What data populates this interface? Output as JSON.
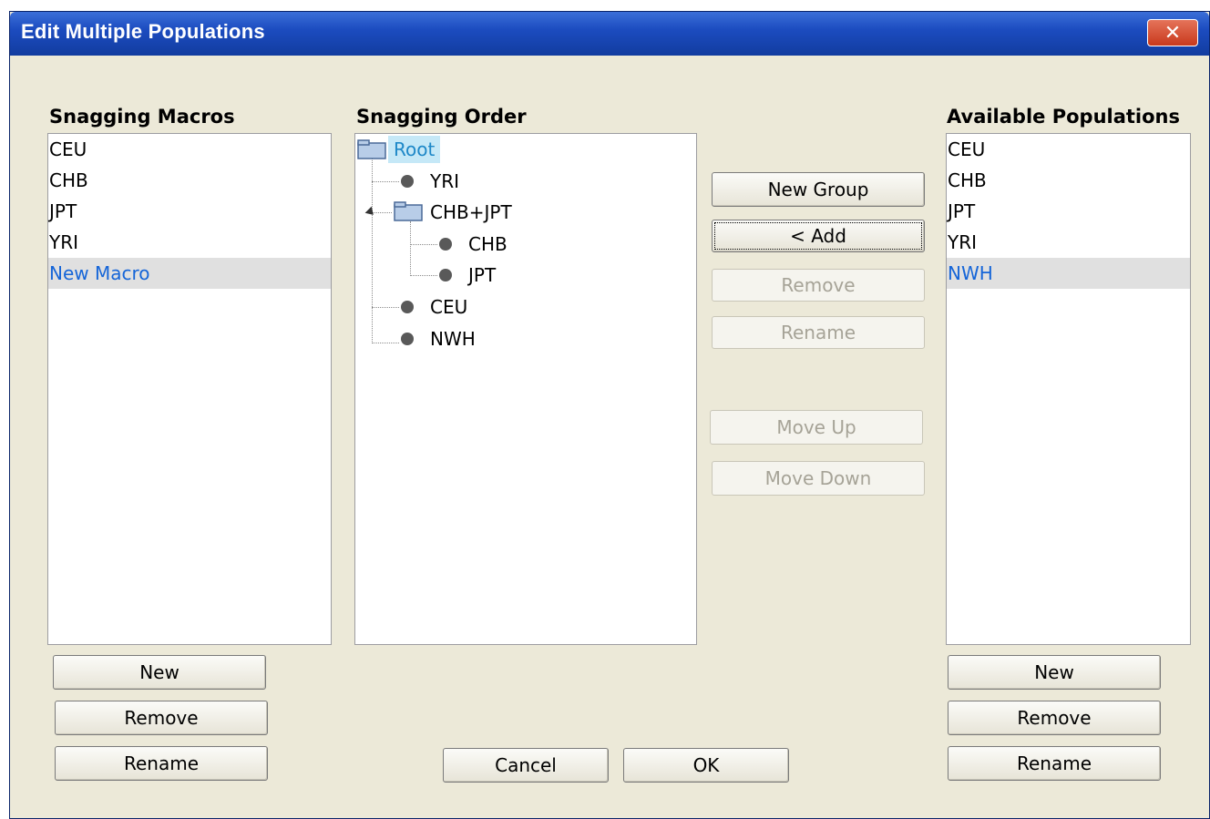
{
  "window": {
    "title": "Edit Multiple Populations",
    "close_label": "✕"
  },
  "macros": {
    "label": "Snagging Macros",
    "items": [
      "CEU",
      "CHB",
      "JPT",
      "YRI",
      "New Macro"
    ],
    "selected": "New Macro",
    "buttons": {
      "new": "New",
      "remove": "Remove",
      "rename": "Rename"
    }
  },
  "order": {
    "label": "Snagging Order",
    "root": "Root",
    "nodes": {
      "yri": "YRI",
      "group": "CHB+JPT",
      "chb": "CHB",
      "jpt": "JPT",
      "ceu": "CEU",
      "nwh": "NWH"
    }
  },
  "middle_buttons": {
    "new_group": "New Group",
    "add": "< Add",
    "remove": "Remove",
    "rename": "Rename",
    "move_up": "Move Up",
    "move_down": "Move Down"
  },
  "available": {
    "label": "Available Populations",
    "items": [
      "CEU",
      "CHB",
      "JPT",
      "YRI",
      "NWH"
    ],
    "selected": "NWH",
    "buttons": {
      "new": "New",
      "remove": "Remove",
      "rename": "Rename"
    }
  },
  "footer": {
    "cancel": "Cancel",
    "ok": "OK"
  },
  "colors": {
    "titlebar": "#123c9f",
    "dialog_bg": "#ece9d8",
    "selected_text": "#1565d8"
  },
  "icons": [
    "close-icon",
    "folder-icon",
    "leaf-node-icon",
    "tree-expander-icon"
  ]
}
